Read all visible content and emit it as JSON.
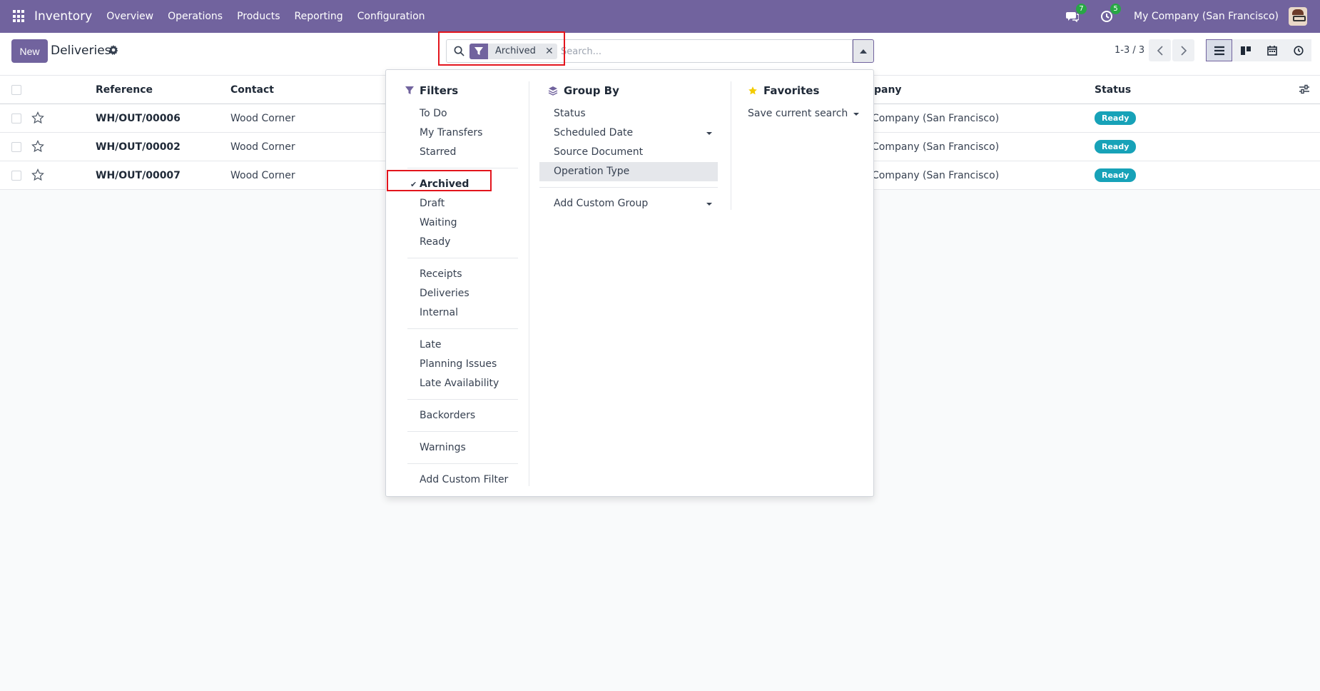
{
  "navbar": {
    "app_name": "Inventory",
    "menu": [
      "Overview",
      "Operations",
      "Products",
      "Reporting",
      "Configuration"
    ],
    "messages_count": "7",
    "activities_count": "5",
    "company": "My Company (San Francisco)",
    "icons": [
      "apps-grid-icon",
      "chat-icon",
      "clock-icon",
      "avatar"
    ]
  },
  "control": {
    "new_label": "New",
    "title": "Deliveries",
    "facet_label": "Archived",
    "search_placeholder": "Search...",
    "pager": "1-3 / 3"
  },
  "list": {
    "columns": [
      "Reference",
      "Contact",
      "Company",
      "Status"
    ],
    "company_header_visible": "pany",
    "rows": [
      {
        "reference": "WH/OUT/00006",
        "contact": "Wood Corner",
        "company": "Company (San Francisco)",
        "status": "Ready"
      },
      {
        "reference": "WH/OUT/00002",
        "contact": "Wood Corner",
        "company": "Company (San Francisco)",
        "status": "Ready"
      },
      {
        "reference": "WH/OUT/00007",
        "contact": "Wood Corner",
        "company": "Company (San Francisco)",
        "status": "Ready"
      }
    ]
  },
  "dropdown": {
    "filters_title": "Filters",
    "filters": {
      "g1": [
        "To Do",
        "My Transfers",
        "Starred"
      ],
      "g2": [
        "Archived",
        "Draft",
        "Waiting",
        "Ready"
      ],
      "g3": [
        "Receipts",
        "Deliveries",
        "Internal"
      ],
      "g4": [
        "Late",
        "Planning Issues",
        "Late Availability"
      ],
      "g5": [
        "Backorders"
      ],
      "g6": [
        "Warnings"
      ],
      "add_custom": "Add Custom Filter"
    },
    "groupby_title": "Group By",
    "groupby": [
      "Status",
      "Scheduled Date",
      "Source Document",
      "Operation Type"
    ],
    "add_custom_group": "Add Custom Group",
    "favorites_title": "Favorites",
    "save_search": "Save current search"
  },
  "colors": {
    "brand": "#71639e",
    "badge": "#17a2b8",
    "highlight": "#e3151d"
  }
}
